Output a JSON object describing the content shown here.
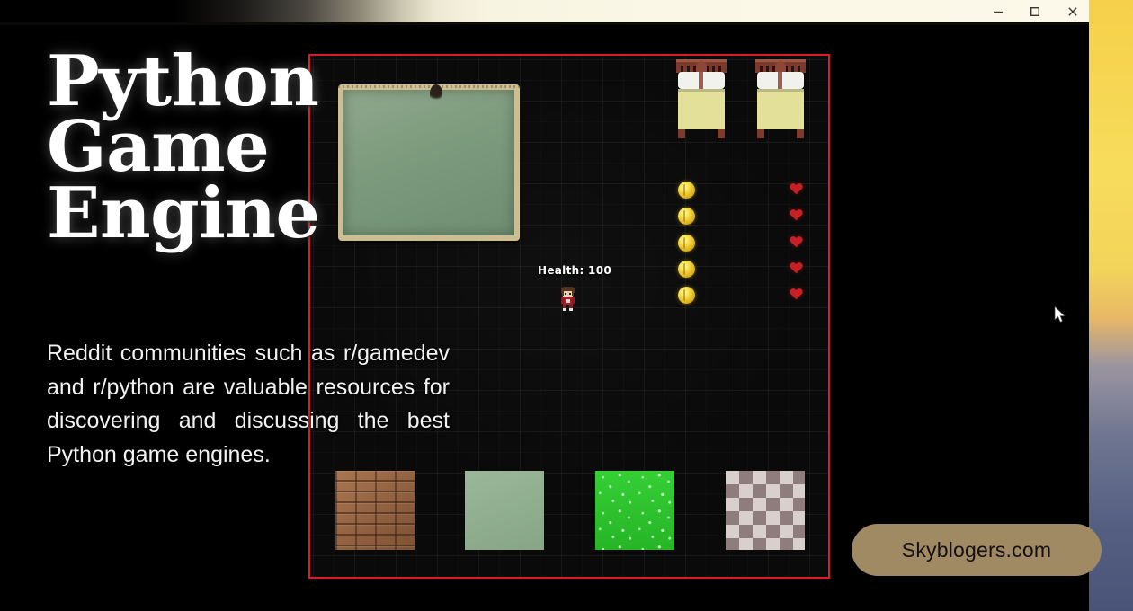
{
  "window": {
    "controls": [
      {
        "name": "minimize",
        "glyph": "minimize-icon"
      },
      {
        "name": "maximize",
        "glyph": "maximize-icon"
      },
      {
        "name": "close",
        "glyph": "close-icon"
      }
    ]
  },
  "slide": {
    "title": "Python Game\nEngine",
    "body": "Reddit communities such as r/gamedev and r/python are valuable resources for discovering and discussing the best Python game engines."
  },
  "game": {
    "hud": {
      "health_label": "Health: 100"
    },
    "objects": {
      "chalkboard": "chalkboard",
      "beds_count": 2,
      "coins_count": 5,
      "hearts_count": 5,
      "player": "player-character-sprite"
    },
    "tiles": [
      {
        "id": "tile-brick",
        "label": "brick-wall-tile"
      },
      {
        "id": "tile-green",
        "label": "plain-green-tile"
      },
      {
        "id": "tile-grass",
        "label": "grass-tile"
      },
      {
        "id": "tile-checker",
        "label": "checkered-floor-tile"
      }
    ],
    "border_color": "#d81c23"
  },
  "watermark": {
    "text": "Skyblogers.com",
    "background": "#a08a63"
  },
  "colors": {
    "title_bar_accent": "#fbf7e6",
    "desktop_top": "#f6d04a",
    "desktop_bottom": "#4a5478",
    "coin": "#f2d23a",
    "heart": "#c71f23",
    "chalkboard": "#7c9a7d",
    "chalkboard_frame": "#cdbe92"
  }
}
